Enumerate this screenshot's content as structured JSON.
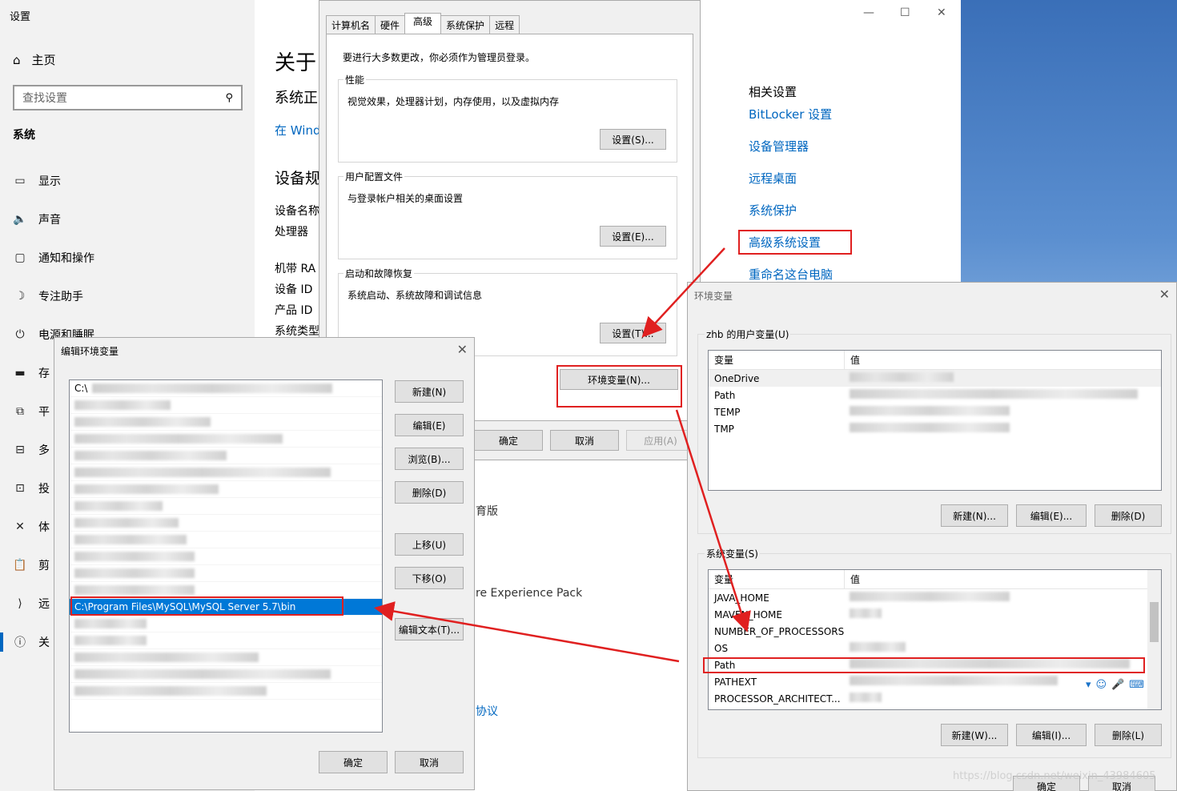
{
  "settings": {
    "window_title": "设置",
    "home": "主页",
    "search_placeholder": "查找设置",
    "section": "系统",
    "nav": [
      "显示",
      "声音",
      "通知和操作",
      "专注助手",
      "电源和睡眠",
      "存",
      "平",
      "多",
      "投",
      "体",
      "剪",
      "远",
      "关"
    ],
    "main_fragments": {
      "about": "关于",
      "system_sub": "系统正",
      "windows_link": "在 Wind",
      "device_spec": "设备规",
      "device_name": "设备名称",
      "processor": "处理器",
      "ram": "机带 RA",
      "device_id": "设备 ID",
      "product_id": "产品 ID",
      "system_type": "系统类型",
      "edition_frag": "育版",
      "experience_pack": "re Experience Pack",
      "agreement_frag": "协议"
    },
    "related": {
      "title": "相关设置",
      "links": [
        "BitLocker 设置",
        "设备管理器",
        "远程桌面",
        "系统保护",
        "高级系统设置",
        "重命名这台电脑"
      ]
    }
  },
  "sysprops": {
    "tabs": [
      "计算机名",
      "硬件",
      "高级",
      "系统保护",
      "远程"
    ],
    "note": "要进行大多数更改，你必须作为管理员登录。",
    "groups": [
      {
        "label": "性能",
        "desc": "视觉效果，处理器计划，内存使用，以及虚拟内存",
        "button": "设置(S)..."
      },
      {
        "label": "用户配置文件",
        "desc": "与登录帐户相关的桌面设置",
        "button": "设置(E)..."
      },
      {
        "label": "启动和故障恢复",
        "desc": "系统启动、系统故障和调试信息",
        "button": "设置(T)..."
      }
    ],
    "env_button": "环境变量(N)...",
    "ok": "确定",
    "cancel": "取消",
    "apply": "应用(A)"
  },
  "envvars": {
    "title": "环境变量",
    "user_group": "zhb 的用户变量(U)",
    "col_var": "变量",
    "col_val": "值",
    "user_vars": [
      "OneDrive",
      "Path",
      "TEMP",
      "TMP"
    ],
    "user_buttons": [
      "新建(N)...",
      "编辑(E)...",
      "删除(D)"
    ],
    "sys_group": "系统变量(S)",
    "sys_vars": [
      "JAVA_HOME",
      "MAVEN_HOME",
      "NUMBER_OF_PROCESSORS",
      "OS",
      "Path",
      "PATHEXT",
      "PROCESSOR_ARCHITECT..."
    ],
    "sys_buttons": [
      "新建(W)...",
      "编辑(I)...",
      "删除(L)"
    ],
    "ok": "确定",
    "cancel": "取消"
  },
  "editenv": {
    "title": "编辑环境变量",
    "first_entry": "C:\\",
    "selected_entry": "C:\\Program Files\\MySQL\\MySQL Server 5.7\\bin",
    "buttons": [
      "新建(N)",
      "编辑(E)",
      "浏览(B)...",
      "删除(D)",
      "上移(U)",
      "下移(O)",
      "编辑文本(T)..."
    ],
    "ok": "确定",
    "cancel": "取消"
  },
  "watermark": "https://blog.csdn.net/weixin_43984605",
  "colors": {
    "accent": "#0067c0",
    "selection": "#0078d7",
    "annotation": "#e02020"
  }
}
